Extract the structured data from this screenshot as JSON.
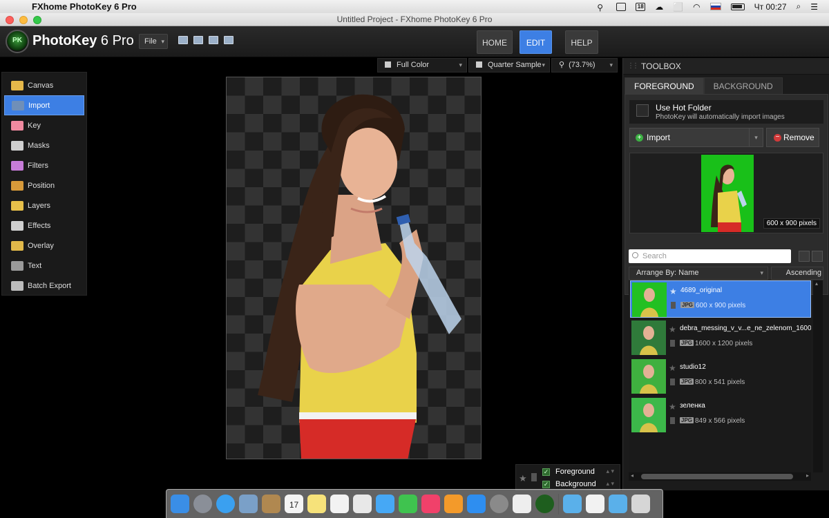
{
  "menubar": {
    "app_name": "FXhome PhotoKey 6 Pro",
    "calendar_day": "18",
    "clock": "Чт 00:27"
  },
  "window": {
    "title": "Untitled Project - FXhome PhotoKey 6 Pro"
  },
  "header": {
    "brand_bold": "PhotoKey",
    "brand_version": " 6 Pro",
    "file_menu": "File",
    "nav": [
      "HOME",
      "EDIT",
      "HELP"
    ],
    "active_nav": "EDIT"
  },
  "sidebar": {
    "items": [
      {
        "label": "Canvas",
        "color": "#e6b84a"
      },
      {
        "label": "Import",
        "color": "#6f8fb8"
      },
      {
        "label": "Key",
        "color": "#f08aa0"
      },
      {
        "label": "Masks",
        "color": "#cfcfcf"
      },
      {
        "label": "Filters",
        "color": "#c77cd8"
      },
      {
        "label": "Position",
        "color": "#d79a3a"
      },
      {
        "label": "Layers",
        "color": "#e7c04a"
      },
      {
        "label": "Effects",
        "color": "#d0d0d0"
      },
      {
        "label": "Overlay",
        "color": "#e2b94a"
      },
      {
        "label": "Text",
        "color": "#9a9a9a"
      },
      {
        "label": "Batch Export",
        "color": "#bcbcbc"
      }
    ],
    "active": "Import"
  },
  "viewbar": {
    "color_mode": "Full Color",
    "sample": "Quarter Sample",
    "zoom": "(73.7%)"
  },
  "layers": {
    "foreground": "Foreground",
    "background": "Background"
  },
  "toolbox": {
    "title": "TOOLBOX",
    "tabs": [
      "FOREGROUND",
      "BACKGROUND"
    ],
    "active_tab": "FOREGROUND",
    "hot_folder_title": "Use Hot Folder",
    "hot_folder_sub": "PhotoKey will automatically import images",
    "import_label": "Import",
    "remove_label": "Remove",
    "preview_dims": "600 x 900 pixels",
    "search_placeholder": "Search",
    "arrange_by": "Arrange By: Name",
    "order": "Ascending",
    "files": [
      {
        "name": "4689_original",
        "type": "JPG",
        "dims": "600 x 900 pixels",
        "selected": true,
        "bg": "#22c022"
      },
      {
        "name": "debra_messing_v_v...e_ne_zelenom_1600",
        "type": "JPG",
        "dims": "1600 x 1200 pixels",
        "selected": false,
        "bg": "#2f7a3a"
      },
      {
        "name": "studio12",
        "type": "JPG",
        "dims": "800 x 541 pixels",
        "selected": false,
        "bg": "#3fb03f"
      },
      {
        "name": "зеленка",
        "type": "JPG",
        "dims": "849 x 566 pixels",
        "selected": false,
        "bg": "#3cb84a"
      }
    ]
  },
  "dock": {
    "icons": [
      {
        "name": "finder-icon",
        "color": "#3a8ee6"
      },
      {
        "name": "launchpad-icon",
        "color": "#8a8f98"
      },
      {
        "name": "safari-icon",
        "color": "#3aa0f0"
      },
      {
        "name": "preview-icon",
        "color": "#7aa0c8"
      },
      {
        "name": "contacts-icon",
        "color": "#b08850"
      },
      {
        "name": "calendar-icon",
        "color": "#f4f4f4"
      },
      {
        "name": "notes-icon",
        "color": "#f6e27a"
      },
      {
        "name": "reminders-icon",
        "color": "#f2f2f2"
      },
      {
        "name": "photos-icon",
        "color": "#e8e8e8"
      },
      {
        "name": "messages-icon",
        "color": "#46a8f5"
      },
      {
        "name": "facetime-icon",
        "color": "#3fc34f"
      },
      {
        "name": "itunes-icon",
        "color": "#f0416a"
      },
      {
        "name": "ibooks-icon",
        "color": "#f39a2a"
      },
      {
        "name": "app-store-icon",
        "color": "#2e8ef0"
      },
      {
        "name": "system-preferences-icon",
        "color": "#8a8a8a"
      },
      {
        "name": "textedit-icon",
        "color": "#eeeeee"
      },
      {
        "name": "photokey-icon",
        "color": "#1e5e1e"
      }
    ],
    "right_icons": [
      {
        "name": "downloads-folder-icon",
        "color": "#5ab0ea"
      },
      {
        "name": "documents-icon",
        "color": "#f2f2f2"
      },
      {
        "name": "applications-folder-icon",
        "color": "#5ab0ea"
      },
      {
        "name": "trash-icon",
        "color": "#d6d6d6"
      }
    ],
    "calendar_day": "17"
  }
}
